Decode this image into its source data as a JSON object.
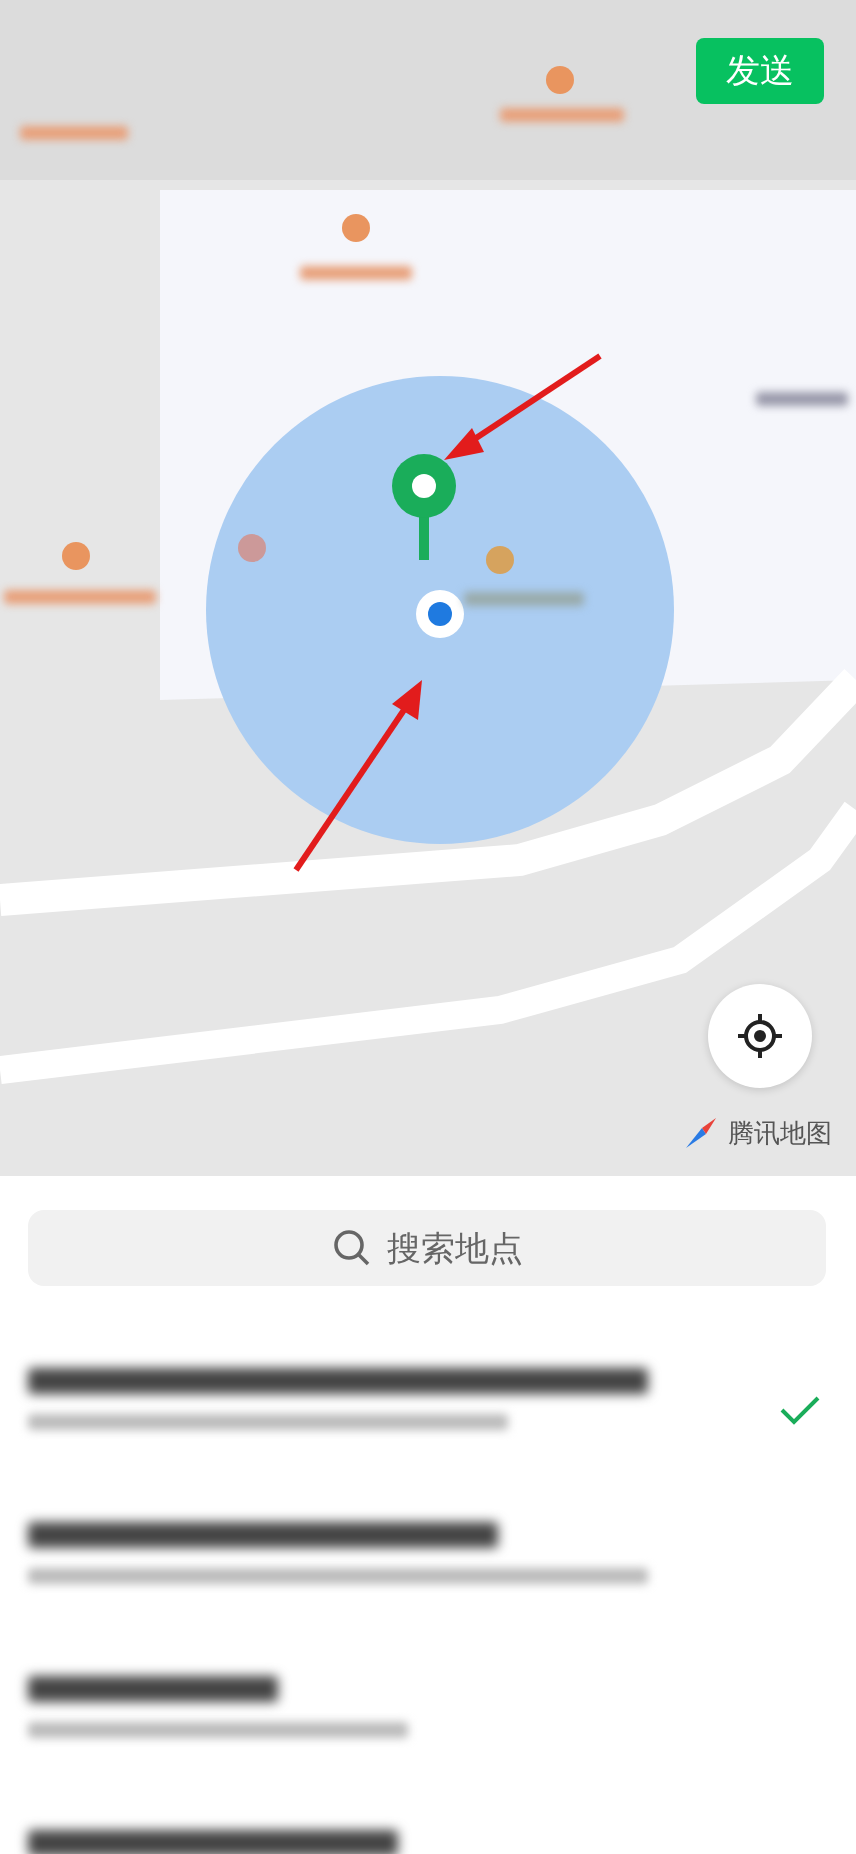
{
  "map": {
    "send_button": "发送",
    "attribution": "腾讯地图"
  },
  "search": {
    "placeholder": "搜索地点"
  },
  "places": [
    {
      "selected": true
    },
    {
      "selected": false
    },
    {
      "selected": false
    },
    {
      "selected": false
    }
  ]
}
